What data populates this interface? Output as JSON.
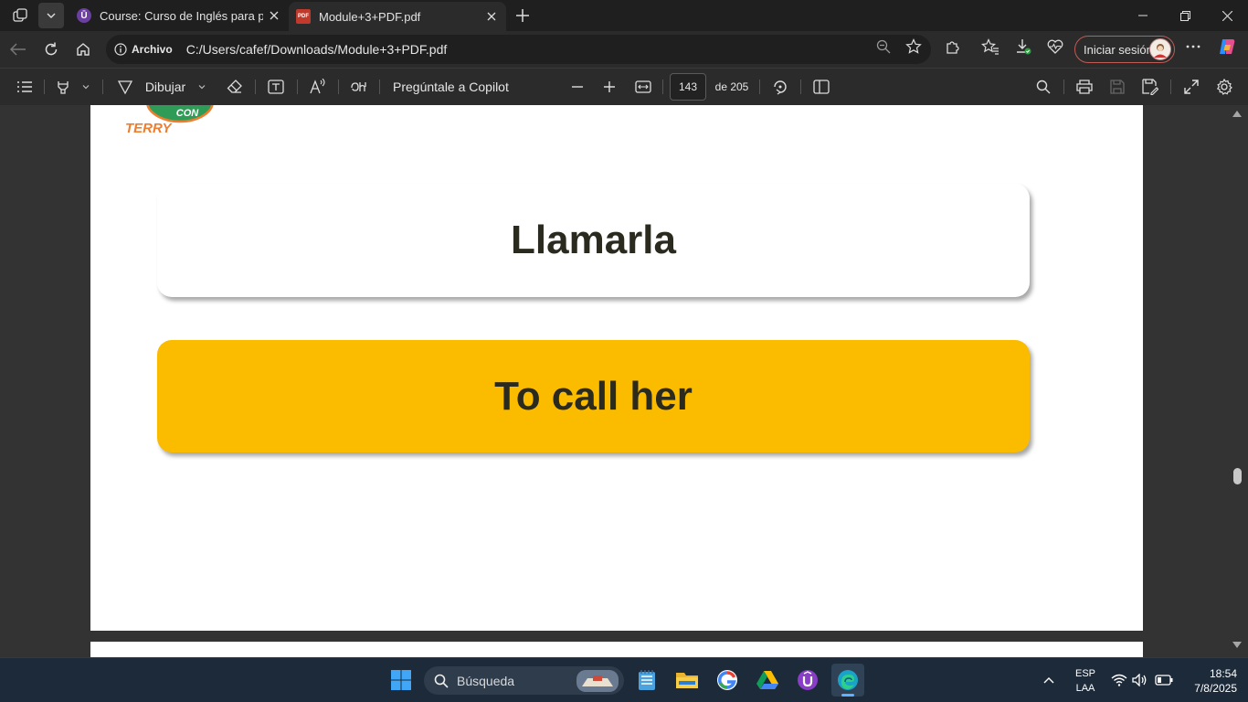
{
  "browser": {
    "tabs": [
      {
        "title": "Course: Curso de Inglés para principiantes",
        "active": false
      },
      {
        "title": "Module+3+PDF.pdf",
        "active": true
      }
    ],
    "address": {
      "info_label": "Archivo",
      "url": "C:/Users/cafef/Downloads/Module+3+PDF.pdf"
    },
    "signin_label": "Iniciar sesión"
  },
  "pdf_toolbar": {
    "draw_label": "Dibujar",
    "copilot_label": "Pregúntale a Copilot",
    "page_current": "143",
    "page_total_label": "de 205"
  },
  "document": {
    "logo_text": "CON TERRY",
    "card_white_text": "Llamarla",
    "card_yellow_text": "To call her",
    "colors": {
      "yellow": "#fbbc00",
      "logo_green": "#2e9b57",
      "logo_orange": "#ee7d2e"
    }
  },
  "taskbar": {
    "search_placeholder": "Búsqueda",
    "lang_top": "ESP",
    "lang_bottom": "LAA",
    "time": "18:54",
    "date": "7/8/2025"
  }
}
